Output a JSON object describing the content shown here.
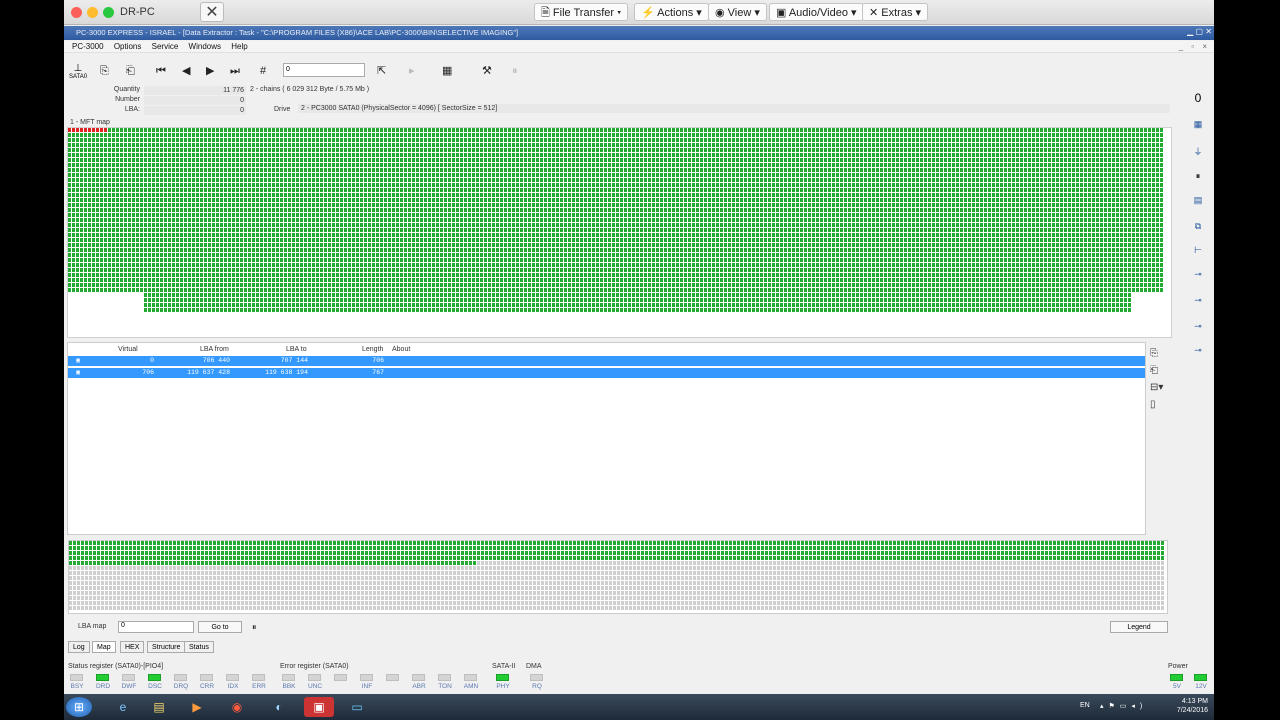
{
  "rd": {
    "title": "DR-PC",
    "menus": [
      "File Transfer",
      "Actions",
      "View",
      "Audio/Video",
      "Extras"
    ]
  },
  "app": {
    "title": "PC-3000 EXPRESS - ISRAEL - [Data Extractor : Task - \"C:\\PROGRAM FILES (X86)\\ACE LAB\\PC-3000\\BIN\\SELECTIVE IMAGING\"]",
    "menu": [
      "PC-3000",
      "Options",
      "Service",
      "Windows",
      "Help"
    ]
  },
  "toolbar": {
    "sata": "SATA0",
    "input": "0"
  },
  "info": {
    "quantity_label": "Quantity",
    "quantity": "11 776",
    "chains": "2 - chains  ( 6 029 312 Byte / 5.75 Mb )",
    "number_label": "Number",
    "number": "0",
    "lba_label": "LBA:",
    "lba": "0",
    "drive_label": "Drive",
    "drive": "2 - PC3000 SATA0 (PhysicalSector = 4096) [ SectorSize = 512]"
  },
  "map": {
    "title": "1 - MFT map"
  },
  "table": {
    "headers": [
      "Virtual",
      "LBA from",
      "LBA to",
      "Length",
      "About"
    ],
    "rows": [
      {
        "virtual": "0",
        "from": "706 440",
        "to": "707 144",
        "length": "706"
      },
      {
        "virtual": "706",
        "from": "119 637 428",
        "to": "119 638 194",
        "length": "767"
      }
    ]
  },
  "bottom": {
    "lba_map": "LBA map",
    "input": "0",
    "goto": "Go to",
    "legend": "Legend",
    "tabs": [
      "Log",
      "Map",
      "HEX",
      "Structure",
      "Status"
    ]
  },
  "status": {
    "status_title": "Status register (SATA0)-[PIO4]",
    "error_title": "Error register (SATA0)",
    "sata_title": "SATA-II",
    "dma_title": "DMA",
    "power_title": "Power",
    "status_leds": [
      "BSY",
      "DRD",
      "DWF",
      "DSC",
      "DRQ",
      "CRR",
      "IDX",
      "ERR"
    ],
    "error_leds": [
      "BBK",
      "UNC",
      "",
      "INF",
      "",
      "ABR",
      "TON",
      "AMN"
    ],
    "sata_led": "PHY",
    "dma_led": "RQ",
    "power_leds": [
      "5V",
      "12V"
    ]
  },
  "tray": {
    "lang": "EN",
    "time": "4:13 PM",
    "date": "7/24/2016"
  }
}
